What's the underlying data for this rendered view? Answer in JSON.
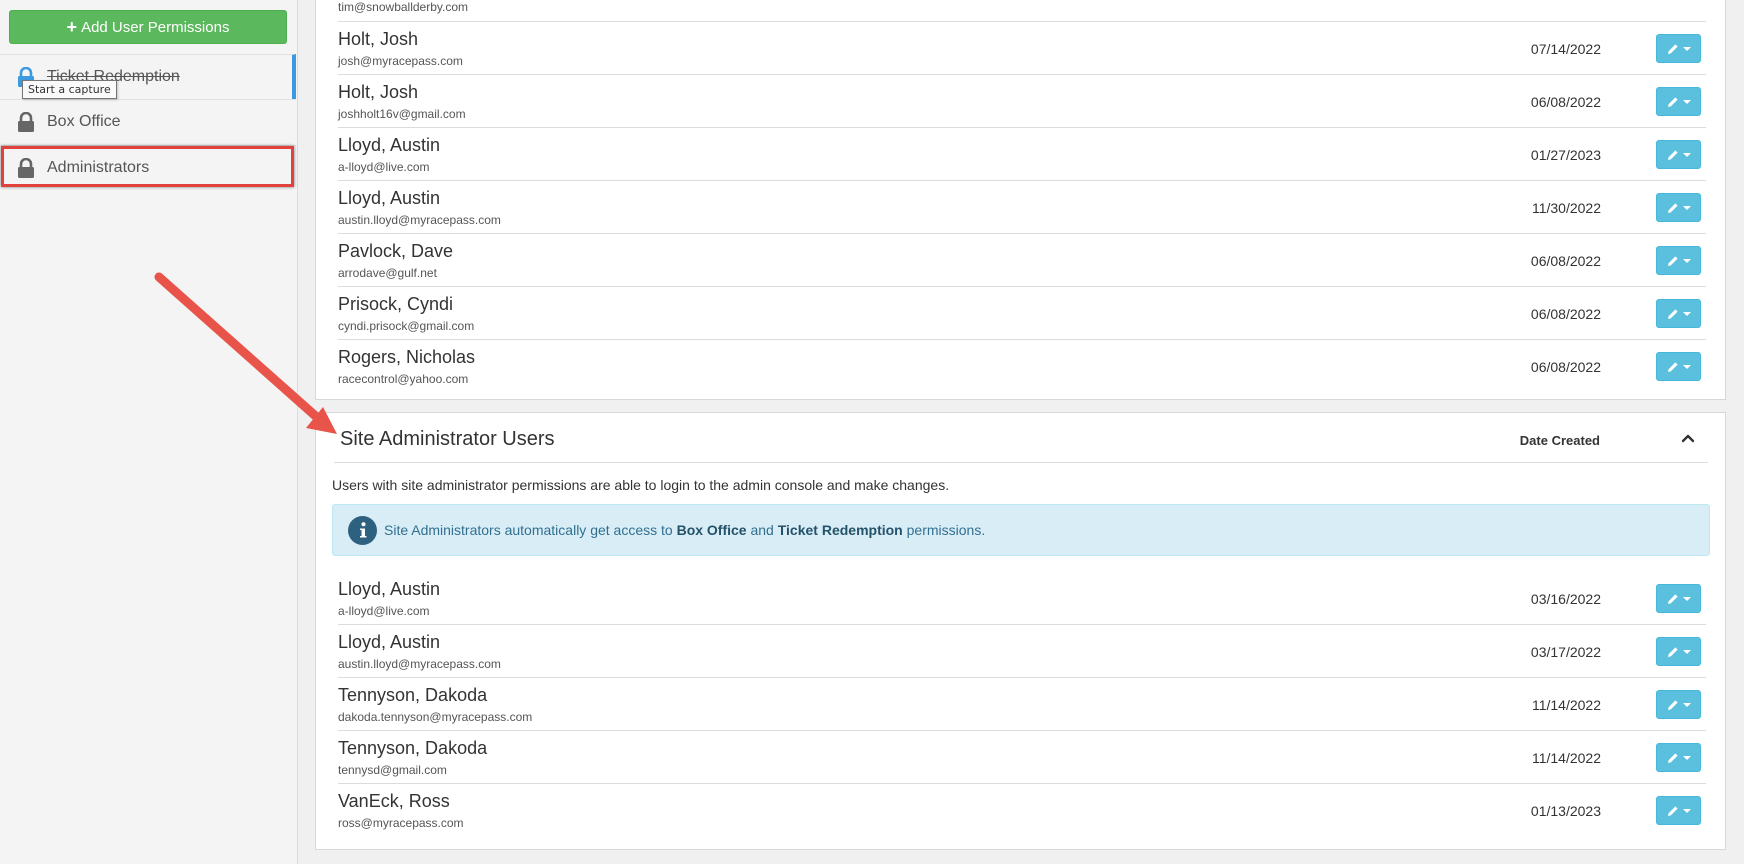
{
  "sidebar": {
    "add_button_label": "Add User Permissions",
    "tooltip": "Start a capture",
    "items": [
      {
        "label": "Ticket Redemption"
      },
      {
        "label": "Box Office"
      },
      {
        "label": "Administrators"
      }
    ]
  },
  "top_panel": {
    "partial_email": "tim@snowballderby.com",
    "users": [
      {
        "name": "Holt, Josh",
        "email": "josh@myracepass.com",
        "date": "07/14/2022"
      },
      {
        "name": "Holt, Josh",
        "email": "joshholt16v@gmail.com",
        "date": "06/08/2022"
      },
      {
        "name": "Lloyd, Austin",
        "email": "a-lloyd@live.com",
        "date": "01/27/2023"
      },
      {
        "name": "Lloyd, Austin",
        "email": "austin.lloyd@myracepass.com",
        "date": "11/30/2022"
      },
      {
        "name": "Pavlock, Dave",
        "email": "arrodave@gulf.net",
        "date": "06/08/2022"
      },
      {
        "name": "Prisock, Cyndi",
        "email": "cyndi.prisock@gmail.com",
        "date": "06/08/2022"
      },
      {
        "name": "Rogers, Nicholas",
        "email": "racecontrol@yahoo.com",
        "date": "06/08/2022"
      }
    ]
  },
  "admin_panel": {
    "title": "Site Administrator Users",
    "column_header": "Date Created",
    "description": "Users with site administrator permissions are able to login to the admin console and make changes.",
    "info": {
      "prefix": "Site Administrators automatically get access to",
      "box_office": "Box Office",
      "and": "and",
      "ticket_redemption": "Ticket Redemption",
      "suffix": "permissions."
    },
    "users": [
      {
        "name": "Lloyd, Austin",
        "email": "a-lloyd@live.com",
        "date": "03/16/2022"
      },
      {
        "name": "Lloyd, Austin",
        "email": "austin.lloyd@myracepass.com",
        "date": "03/17/2022"
      },
      {
        "name": "Tennyson, Dakoda",
        "email": "dakoda.tennyson@myracepass.com",
        "date": "11/14/2022"
      },
      {
        "name": "Tennyson, Dakoda",
        "email": "tennysd@gmail.com",
        "date": "11/14/2022"
      },
      {
        "name": "VanEck, Ross",
        "email": "ross@myracepass.com",
        "date": "01/13/2023"
      }
    ]
  },
  "colors": {
    "add_button": "#5cb85c",
    "edit_button": "#5bc0de",
    "highlight": "#e2423d",
    "info_bg": "#d9edf7"
  }
}
